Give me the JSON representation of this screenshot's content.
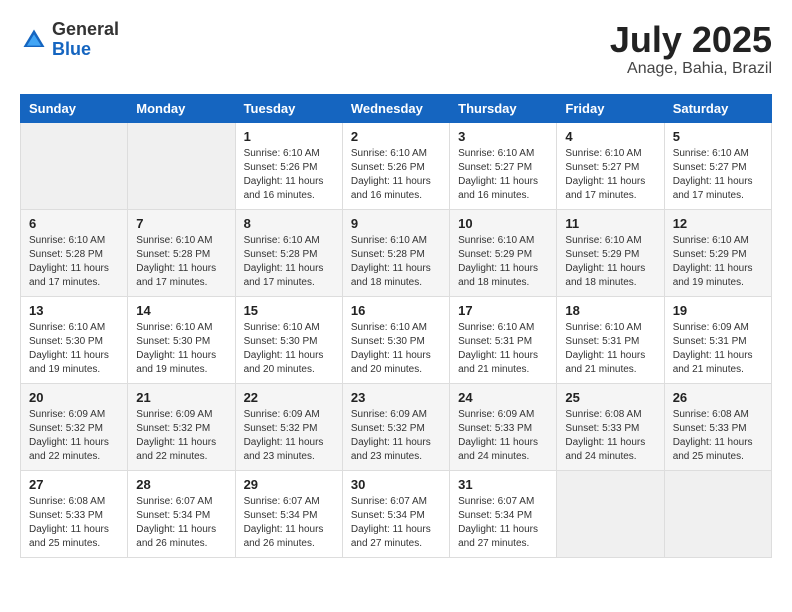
{
  "header": {
    "logo_general": "General",
    "logo_blue": "Blue",
    "month_title": "July 2025",
    "subtitle": "Anage, Bahia, Brazil"
  },
  "weekdays": [
    "Sunday",
    "Monday",
    "Tuesday",
    "Wednesday",
    "Thursday",
    "Friday",
    "Saturday"
  ],
  "weeks": [
    [
      {
        "day": "",
        "sunrise": "",
        "sunset": "",
        "daylight": "",
        "empty": true
      },
      {
        "day": "",
        "sunrise": "",
        "sunset": "",
        "daylight": "",
        "empty": true
      },
      {
        "day": "1",
        "sunrise": "Sunrise: 6:10 AM",
        "sunset": "Sunset: 5:26 PM",
        "daylight": "Daylight: 11 hours and 16 minutes."
      },
      {
        "day": "2",
        "sunrise": "Sunrise: 6:10 AM",
        "sunset": "Sunset: 5:26 PM",
        "daylight": "Daylight: 11 hours and 16 minutes."
      },
      {
        "day": "3",
        "sunrise": "Sunrise: 6:10 AM",
        "sunset": "Sunset: 5:27 PM",
        "daylight": "Daylight: 11 hours and 16 minutes."
      },
      {
        "day": "4",
        "sunrise": "Sunrise: 6:10 AM",
        "sunset": "Sunset: 5:27 PM",
        "daylight": "Daylight: 11 hours and 17 minutes."
      },
      {
        "day": "5",
        "sunrise": "Sunrise: 6:10 AM",
        "sunset": "Sunset: 5:27 PM",
        "daylight": "Daylight: 11 hours and 17 minutes."
      }
    ],
    [
      {
        "day": "6",
        "sunrise": "Sunrise: 6:10 AM",
        "sunset": "Sunset: 5:28 PM",
        "daylight": "Daylight: 11 hours and 17 minutes."
      },
      {
        "day": "7",
        "sunrise": "Sunrise: 6:10 AM",
        "sunset": "Sunset: 5:28 PM",
        "daylight": "Daylight: 11 hours and 17 minutes."
      },
      {
        "day": "8",
        "sunrise": "Sunrise: 6:10 AM",
        "sunset": "Sunset: 5:28 PM",
        "daylight": "Daylight: 11 hours and 17 minutes."
      },
      {
        "day": "9",
        "sunrise": "Sunrise: 6:10 AM",
        "sunset": "Sunset: 5:28 PM",
        "daylight": "Daylight: 11 hours and 18 minutes."
      },
      {
        "day": "10",
        "sunrise": "Sunrise: 6:10 AM",
        "sunset": "Sunset: 5:29 PM",
        "daylight": "Daylight: 11 hours and 18 minutes."
      },
      {
        "day": "11",
        "sunrise": "Sunrise: 6:10 AM",
        "sunset": "Sunset: 5:29 PM",
        "daylight": "Daylight: 11 hours and 18 minutes."
      },
      {
        "day": "12",
        "sunrise": "Sunrise: 6:10 AM",
        "sunset": "Sunset: 5:29 PM",
        "daylight": "Daylight: 11 hours and 19 minutes."
      }
    ],
    [
      {
        "day": "13",
        "sunrise": "Sunrise: 6:10 AM",
        "sunset": "Sunset: 5:30 PM",
        "daylight": "Daylight: 11 hours and 19 minutes."
      },
      {
        "day": "14",
        "sunrise": "Sunrise: 6:10 AM",
        "sunset": "Sunset: 5:30 PM",
        "daylight": "Daylight: 11 hours and 19 minutes."
      },
      {
        "day": "15",
        "sunrise": "Sunrise: 6:10 AM",
        "sunset": "Sunset: 5:30 PM",
        "daylight": "Daylight: 11 hours and 20 minutes."
      },
      {
        "day": "16",
        "sunrise": "Sunrise: 6:10 AM",
        "sunset": "Sunset: 5:30 PM",
        "daylight": "Daylight: 11 hours and 20 minutes."
      },
      {
        "day": "17",
        "sunrise": "Sunrise: 6:10 AM",
        "sunset": "Sunset: 5:31 PM",
        "daylight": "Daylight: 11 hours and 21 minutes."
      },
      {
        "day": "18",
        "sunrise": "Sunrise: 6:10 AM",
        "sunset": "Sunset: 5:31 PM",
        "daylight": "Daylight: 11 hours and 21 minutes."
      },
      {
        "day": "19",
        "sunrise": "Sunrise: 6:09 AM",
        "sunset": "Sunset: 5:31 PM",
        "daylight": "Daylight: 11 hours and 21 minutes."
      }
    ],
    [
      {
        "day": "20",
        "sunrise": "Sunrise: 6:09 AM",
        "sunset": "Sunset: 5:32 PM",
        "daylight": "Daylight: 11 hours and 22 minutes."
      },
      {
        "day": "21",
        "sunrise": "Sunrise: 6:09 AM",
        "sunset": "Sunset: 5:32 PM",
        "daylight": "Daylight: 11 hours and 22 minutes."
      },
      {
        "day": "22",
        "sunrise": "Sunrise: 6:09 AM",
        "sunset": "Sunset: 5:32 PM",
        "daylight": "Daylight: 11 hours and 23 minutes."
      },
      {
        "day": "23",
        "sunrise": "Sunrise: 6:09 AM",
        "sunset": "Sunset: 5:32 PM",
        "daylight": "Daylight: 11 hours and 23 minutes."
      },
      {
        "day": "24",
        "sunrise": "Sunrise: 6:09 AM",
        "sunset": "Sunset: 5:33 PM",
        "daylight": "Daylight: 11 hours and 24 minutes."
      },
      {
        "day": "25",
        "sunrise": "Sunrise: 6:08 AM",
        "sunset": "Sunset: 5:33 PM",
        "daylight": "Daylight: 11 hours and 24 minutes."
      },
      {
        "day": "26",
        "sunrise": "Sunrise: 6:08 AM",
        "sunset": "Sunset: 5:33 PM",
        "daylight": "Daylight: 11 hours and 25 minutes."
      }
    ],
    [
      {
        "day": "27",
        "sunrise": "Sunrise: 6:08 AM",
        "sunset": "Sunset: 5:33 PM",
        "daylight": "Daylight: 11 hours and 25 minutes."
      },
      {
        "day": "28",
        "sunrise": "Sunrise: 6:07 AM",
        "sunset": "Sunset: 5:34 PM",
        "daylight": "Daylight: 11 hours and 26 minutes."
      },
      {
        "day": "29",
        "sunrise": "Sunrise: 6:07 AM",
        "sunset": "Sunset: 5:34 PM",
        "daylight": "Daylight: 11 hours and 26 minutes."
      },
      {
        "day": "30",
        "sunrise": "Sunrise: 6:07 AM",
        "sunset": "Sunset: 5:34 PM",
        "daylight": "Daylight: 11 hours and 27 minutes."
      },
      {
        "day": "31",
        "sunrise": "Sunrise: 6:07 AM",
        "sunset": "Sunset: 5:34 PM",
        "daylight": "Daylight: 11 hours and 27 minutes."
      },
      {
        "day": "",
        "sunrise": "",
        "sunset": "",
        "daylight": "",
        "empty": true
      },
      {
        "day": "",
        "sunrise": "",
        "sunset": "",
        "daylight": "",
        "empty": true
      }
    ]
  ]
}
